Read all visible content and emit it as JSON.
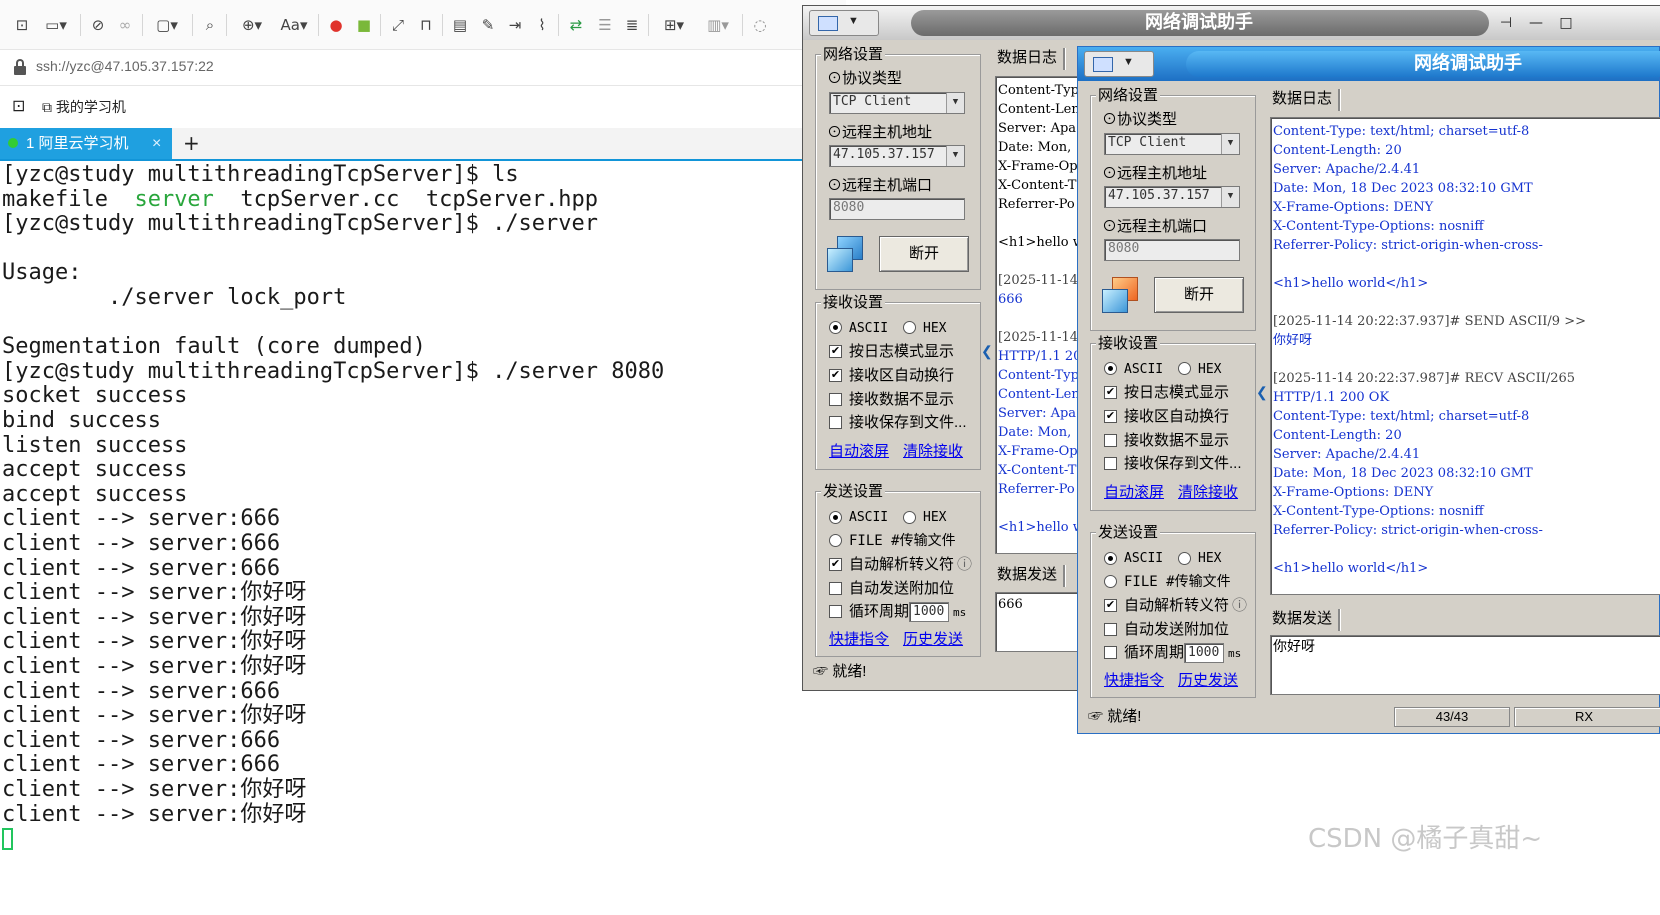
{
  "ssh": {
    "toolbar_icons": [
      "new-session-icon",
      "open-folder-icon",
      "disconnect-icon",
      "link-icon",
      "new-window-icon",
      "search-icon",
      "globe-icon",
      "font-icon",
      "weibo-icon",
      "android-icon",
      "fullscreen-icon",
      "lock-icon",
      "keyboard-icon",
      "brush-icon",
      "export-icon",
      "script-icon",
      "sftp-icon",
      "compose-icon",
      "log-icon",
      "add-pane-icon",
      "layout-icon",
      "chat-icon"
    ],
    "address": "ssh://yzc@47.105.37.157:22",
    "bookmark_label": "我的学习机",
    "tab_label": "1 阿里云学习机",
    "tab_close": "×",
    "tab_add": "+",
    "terminal_lines": [
      "[yzc@study multithreadingTcpServer]$ ls",
      "makefile  ",
      "[yzc@study multithreadingTcpServer]$ ./server",
      "",
      "Usage:",
      "        ./server lock_port",
      "",
      "Segmentation fault (core dumped)",
      "[yzc@study multithreadingTcpServer]$ ./server 8080",
      "socket success",
      "bind success",
      "listen success",
      "accept success",
      "accept success",
      "client --> server:666",
      "client --> server:666",
      "client --> server:666",
      "client --> server:你好呀",
      "client --> server:你好呀",
      "client --> server:你好呀",
      "client --> server:你好呀",
      "client --> server:666",
      "client --> server:你好呀",
      "client --> server:666",
      "client --> server:666",
      "client --> server:你好呀",
      "client --> server:你好呀"
    ],
    "ls_highlight": "server",
    "ls_rest": "  tcpServer.cc  tcpServer.hpp"
  },
  "win1": {
    "title": "网络调试助手",
    "net_group": "网络设置",
    "proto_label": "⊙协议类型",
    "proto_value": "TCP Client",
    "host_label": "⊙远程主机地址",
    "host_value": "47.105.37.157",
    "port_label": "⊙远程主机端口",
    "port_value": "8080",
    "disconnect": "断开",
    "recv_group": "接收设置",
    "ascii": "ASCII",
    "hex": "HEX",
    "log_mode": "按日志模式显示",
    "auto_wrap": "接收区自动换行",
    "no_show": "接收数据不显示",
    "save_file": "接收保存到文件...",
    "auto_scroll": "自动滚屏",
    "clear_recv": "清除接收",
    "send_group": "发送设置",
    "file_send": "FILE #传输文件",
    "auto_escape": "自动解析转义符",
    "auto_append": "自动发送附加位",
    "loop": "循环周期",
    "loop_value": "1000",
    "ms": "ms",
    "shortcut": "快捷指令",
    "history": "历史发送",
    "log_tab": "数据日志",
    "send_tab": "数据发送",
    "send_text": "666",
    "status": "就绪!",
    "log_lines": [
      {
        "t": "Content-Typ",
        "c": ""
      },
      {
        "t": "Content-Len",
        "c": ""
      },
      {
        "t": "Server: Apa",
        "c": ""
      },
      {
        "t": "Date: Mon, ",
        "c": ""
      },
      {
        "t": "X-Frame-Opt",
        "c": ""
      },
      {
        "t": "X-Content-T",
        "c": ""
      },
      {
        "t": "Referrer-Po",
        "c": ""
      },
      {
        "t": "",
        "c": ""
      },
      {
        "t": "<h1>hello w",
        "c": ""
      },
      {
        "t": "",
        "c": ""
      },
      {
        "t": "[2025-11-14",
        "c": "ts"
      },
      {
        "t": "666",
        "c": "blue"
      },
      {
        "t": "",
        "c": ""
      },
      {
        "t": "[2025-11-14",
        "c": "ts"
      },
      {
        "t": "HTTP/1.1 200",
        "c": "blue"
      },
      {
        "t": "Content-Typ",
        "c": "blue"
      },
      {
        "t": "Content-Len",
        "c": "blue"
      },
      {
        "t": "Server: Apa",
        "c": "blue"
      },
      {
        "t": "Date: Mon, ",
        "c": "blue"
      },
      {
        "t": "X-Frame-Opt",
        "c": "blue"
      },
      {
        "t": "X-Content-T",
        "c": "blue"
      },
      {
        "t": "Referrer-Po",
        "c": "blue"
      },
      {
        "t": "",
        "c": ""
      },
      {
        "t": "<h1>hello w",
        "c": "blue"
      }
    ]
  },
  "win2": {
    "title": "网络调试助手",
    "send_text": "你好呀",
    "status_count": "43/43",
    "status_rx": "RX",
    "log_lines": [
      {
        "t": "Content-Type: text/html; charset=utf-8",
        "c": "blue"
      },
      {
        "t": "Content-Length: 20",
        "c": "blue"
      },
      {
        "t": "Server: Apache/2.4.41",
        "c": "blue"
      },
      {
        "t": "Date: Mon, 18 Dec 2023 08:32:10 GMT",
        "c": "blue"
      },
      {
        "t": "X-Frame-Options: DENY",
        "c": "blue"
      },
      {
        "t": "X-Content-Type-Options: nosniff",
        "c": "blue"
      },
      {
        "t": "Referrer-Policy: strict-origin-when-cross-",
        "c": "blue"
      },
      {
        "t": "",
        "c": ""
      },
      {
        "t": "<h1>hello world</h1>",
        "c": "blue"
      },
      {
        "t": "",
        "c": ""
      },
      {
        "t": "[2025-11-14 20:22:37.937]# SEND ASCII/9 >>",
        "c": "ts"
      },
      {
        "t": "你好呀",
        "c": "blue"
      },
      {
        "t": "",
        "c": ""
      },
      {
        "t": "[2025-11-14 20:22:37.987]# RECV ASCII/265",
        "c": "ts"
      },
      {
        "t": "HTTP/1.1 200 OK",
        "c": "blue"
      },
      {
        "t": "Content-Type: text/html; charset=utf-8",
        "c": "blue"
      },
      {
        "t": "Content-Length: 20",
        "c": "blue"
      },
      {
        "t": "Server: Apache/2.4.41",
        "c": "blue"
      },
      {
        "t": "Date: Mon, 18 Dec 2023 08:32:10 GMT",
        "c": "blue"
      },
      {
        "t": "X-Frame-Options: DENY",
        "c": "blue"
      },
      {
        "t": "X-Content-Type-Options: nosniff",
        "c": "blue"
      },
      {
        "t": "Referrer-Policy: strict-origin-when-cross-",
        "c": "blue"
      },
      {
        "t": "",
        "c": ""
      },
      {
        "t": "<h1>hello world</h1>",
        "c": "blue"
      }
    ]
  },
  "watermark": "CSDN @橘子真甜~"
}
